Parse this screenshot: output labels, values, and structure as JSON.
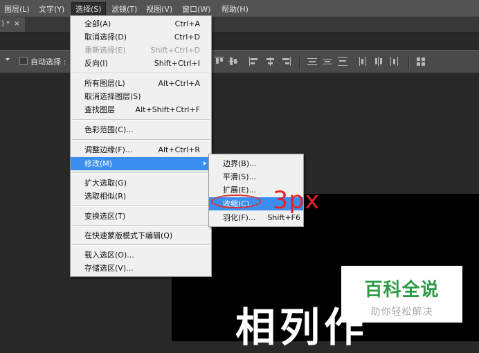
{
  "menubar": {
    "items": [
      "图层(L)",
      "文字(Y)",
      "选择(S)",
      "滤镜(T)",
      "视图(V)",
      "窗口(W)",
      "帮助(H)"
    ]
  },
  "doc_tab": {
    "label": ") *",
    "close": "×"
  },
  "options": {
    "auto_select_label": "自动选择 :"
  },
  "select_menu": {
    "items": [
      {
        "label": "全部(A)",
        "shortcut": "Ctrl+A"
      },
      {
        "label": "取消选择(D)",
        "shortcut": "Ctrl+D"
      },
      {
        "label": "重新选择(E)",
        "shortcut": "Shift+Ctrl+D"
      },
      {
        "label": "反向(I)",
        "shortcut": "Shift+Ctrl+I"
      },
      {
        "label": "所有图层(L)",
        "shortcut": "Alt+Ctrl+A"
      },
      {
        "label": "取消选择图层(S)",
        "shortcut": ""
      },
      {
        "label": "查找图层",
        "shortcut": "Alt+Shift+Ctrl+F"
      },
      {
        "label": "色彩范围(C)...",
        "shortcut": ""
      },
      {
        "label": "调整边缘(F)...",
        "shortcut": "Alt+Ctrl+R"
      },
      {
        "label": "修改(M)",
        "shortcut": ""
      },
      {
        "label": "扩大选取(G)",
        "shortcut": ""
      },
      {
        "label": "选取相似(R)",
        "shortcut": ""
      },
      {
        "label": "变换选区(T)",
        "shortcut": ""
      },
      {
        "label": "在快速蒙版模式下编辑(Q)",
        "shortcut": ""
      },
      {
        "label": "载入选区(O)...",
        "shortcut": ""
      },
      {
        "label": "存储选区(V)...",
        "shortcut": ""
      }
    ]
  },
  "modify_submenu": {
    "items": [
      {
        "label": "边界(B)...",
        "shortcut": ""
      },
      {
        "label": "平滑(S)...",
        "shortcut": ""
      },
      {
        "label": "扩展(E)...",
        "shortcut": ""
      },
      {
        "label": "收缩(C)...",
        "shortcut": ""
      },
      {
        "label": "羽化(F)...",
        "shortcut": "Shift+F6"
      }
    ]
  },
  "annotation": {
    "text": "3px",
    "color": "#e2242a"
  },
  "canvas": {
    "text": "相列作"
  },
  "watermark": {
    "title": "百科全说",
    "subtitle": "助你轻松解决"
  },
  "colors": {
    "highlight": "#3b8ef0",
    "watermark_green": "#2d9a46"
  }
}
